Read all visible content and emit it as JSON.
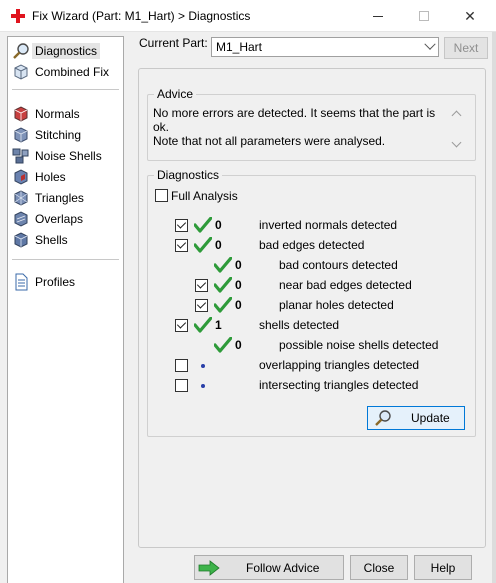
{
  "window": {
    "title": "Fix Wizard (Part: M1_Hart) > Diagnostics",
    "minimize_glyph": "",
    "maximize_glyph": "",
    "close_glyph": "✕"
  },
  "sidebar": {
    "items": [
      {
        "label": "Diagnostics",
        "icon": "magnifier-icon",
        "selected": true
      },
      {
        "label": "Combined Fix",
        "icon": "cube-icon"
      },
      {
        "label": "Normals",
        "icon": "normals-cube-icon"
      },
      {
        "label": "Stitching",
        "icon": "stitching-cube-icon"
      },
      {
        "label": "Noise Shells",
        "icon": "noise-shells-icon"
      },
      {
        "label": "Holes",
        "icon": "holes-cube-icon"
      },
      {
        "label": "Triangles",
        "icon": "triangles-cube-icon"
      },
      {
        "label": "Overlaps",
        "icon": "overlaps-cube-icon"
      },
      {
        "label": "Shells",
        "icon": "shells-cube-icon"
      },
      {
        "label": "Profiles",
        "icon": "document-icon"
      }
    ]
  },
  "header": {
    "current_part_label": "Current Part:",
    "current_part_value": "M1_Hart",
    "next_label": "Next"
  },
  "advice": {
    "title": "Advice",
    "line1": "No more errors are detected. It seems that the part is ok.",
    "line2": "Note that not all parameters were analysed."
  },
  "diagnostics": {
    "title": "Diagnostics",
    "full_analysis_label": "Full Analysis",
    "full_analysis_checked": false,
    "rows": [
      {
        "checked": true,
        "status": "ok",
        "count": "0",
        "label": "inverted normals detected"
      },
      {
        "checked": true,
        "status": "ok",
        "count": "0",
        "label": "bad edges detected"
      },
      {
        "checked": null,
        "status": "ok",
        "count": "0",
        "label": "bad contours detected"
      },
      {
        "checked": true,
        "status": "ok",
        "count": "0",
        "label": "near bad edges detected"
      },
      {
        "checked": true,
        "status": "ok",
        "count": "0",
        "label": "planar holes detected"
      },
      {
        "checked": true,
        "status": "ok",
        "count": "1",
        "label": "shells detected"
      },
      {
        "checked": null,
        "status": "ok",
        "count": "0",
        "label": "possible noise shells detected"
      },
      {
        "checked": false,
        "status": "unknown",
        "count": "",
        "label": "overlapping triangles detected"
      },
      {
        "checked": false,
        "status": "unknown",
        "count": "",
        "label": "intersecting triangles detected"
      }
    ],
    "update_label": "Update"
  },
  "footer": {
    "follow_advice_label": "Follow Advice",
    "close_label": "Close",
    "help_label": "Help"
  },
  "colors": {
    "check_green": "#2e9b3a",
    "accent_blue": "#0078d7",
    "dot_blue": "#2a3fa8",
    "close_red": "#e81123"
  }
}
